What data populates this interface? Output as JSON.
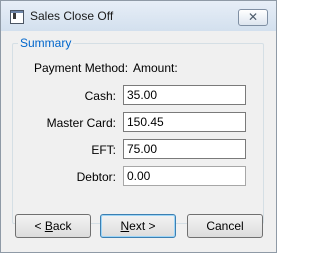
{
  "window": {
    "title": "Sales Close Off",
    "close_glyph": "✕"
  },
  "summary": {
    "legend": "Summary",
    "header_method": "Payment Method:",
    "header_amount": "Amount:",
    "rows": [
      {
        "label": "Cash:",
        "value": "35.00"
      },
      {
        "label": "Master Card:",
        "value": "150.45"
      },
      {
        "label": "EFT:",
        "value": "75.00"
      },
      {
        "label": "Debtor:",
        "value": "0.00"
      }
    ]
  },
  "buttons": {
    "back_prefix": "< ",
    "back_mnemonic": "B",
    "back_rest": "ack",
    "next_mnemonic": "N",
    "next_rest": "ext >",
    "cancel": "Cancel"
  },
  "colors": {
    "legend": "#0066cc",
    "titlebar_top": "#e7eef7",
    "titlebar_bottom": "#d3e0ee"
  }
}
